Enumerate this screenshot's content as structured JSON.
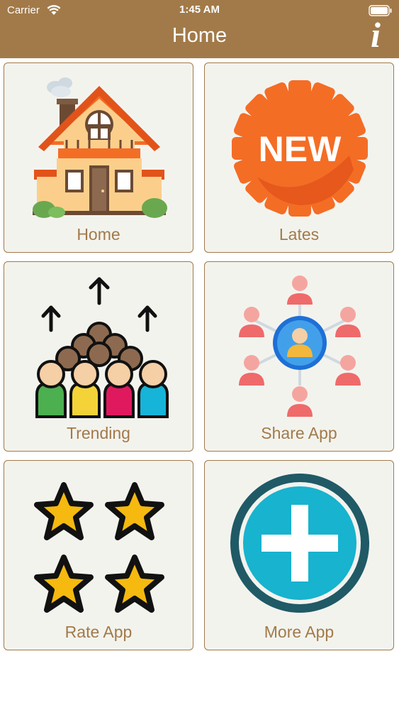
{
  "status_bar": {
    "carrier": "Carrier",
    "time": "1:45 AM"
  },
  "header": {
    "title": "Home",
    "info_icon_glyph": "i"
  },
  "tiles": [
    {
      "label": "Home",
      "icon": "house-icon"
    },
    {
      "label": "Lates",
      "icon": "new-badge-icon",
      "badge_text": "NEW"
    },
    {
      "label": "Trending",
      "icon": "trending-crowd-icon"
    },
    {
      "label": "Share App",
      "icon": "share-network-icon"
    },
    {
      "label": "Rate App",
      "icon": "stars-icon"
    },
    {
      "label": "More App",
      "icon": "plus-circle-icon"
    }
  ],
  "colors": {
    "header_bg": "#a27a49",
    "tile_bg": "#f3f3ee",
    "label": "#a27a49"
  }
}
